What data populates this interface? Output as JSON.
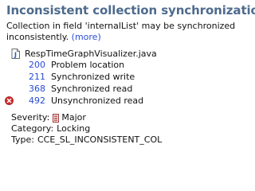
{
  "title": "Inconsistent collection synchronization",
  "description": {
    "line1": "Collection in field 'internalList' may be synchronized",
    "line2": "inconsistently.",
    "more_link": "(more)"
  },
  "file": {
    "icon": "java-file-icon",
    "name": "RespTimeGraphVisualizer.java"
  },
  "locations": [
    {
      "line": "200",
      "label": "Problem location",
      "icon": null
    },
    {
      "line": "211",
      "label": "Synchronized write",
      "icon": null
    },
    {
      "line": "368",
      "label": "Synchronized read",
      "icon": null
    },
    {
      "line": "492",
      "label": "Unsynchronized read",
      "icon": "error-icon"
    }
  ],
  "meta": {
    "severity_label": "Severity:",
    "severity_value": "Major",
    "severity_icon": "major-severity-icon",
    "category_label": "Category:",
    "category_value": "Locking",
    "type_label": "Type:",
    "type_value": "CCE_SL_INCONSISTENT_COL"
  },
  "colors": {
    "title": "#4e6b8d",
    "link": "#2a4bd7",
    "error": "#d22b2b"
  }
}
